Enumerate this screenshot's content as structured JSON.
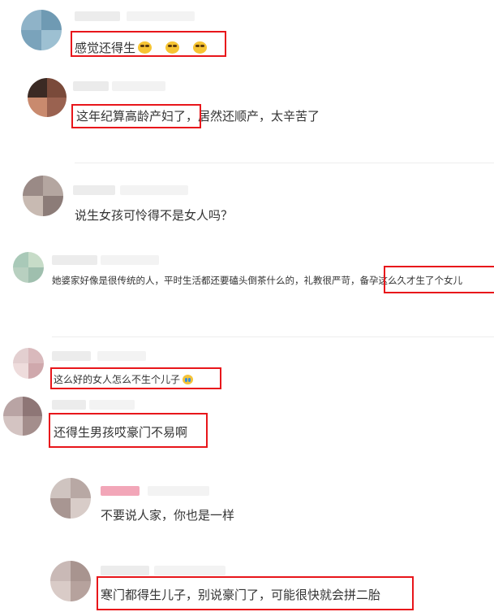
{
  "comments": [
    {
      "text": "感觉还得生"
    },
    {
      "text_boxed": "这年纪算高龄产妇了，",
      "text_rest": "居然还顺产，太辛苦了"
    },
    {
      "text": "说生女孩可怜得不是女人吗？"
    },
    {
      "text_plain": "她婆家好像是很传统的人，平时生活都还要磕头倒茶什么的，礼教很严苛，",
      "text_boxed": "备孕这么久才生了个女儿"
    },
    {
      "text": "这么好的女人怎么不生个儿子"
    },
    {
      "text": "还得生男孩哎豪门不易啊"
    },
    {
      "text": "不要说人家，你也是一样"
    },
    {
      "text": "寒门都得生儿子，别说豪门了，可能很快就会拼二胎"
    }
  ],
  "colors": {
    "highlight": "#e8161b",
    "text": "#333333",
    "divider": "#eeeeee"
  },
  "icons": {
    "laugh_emoji": "grinning-squint-emoji",
    "cry_emoji": "crying-laughing-emoji"
  }
}
